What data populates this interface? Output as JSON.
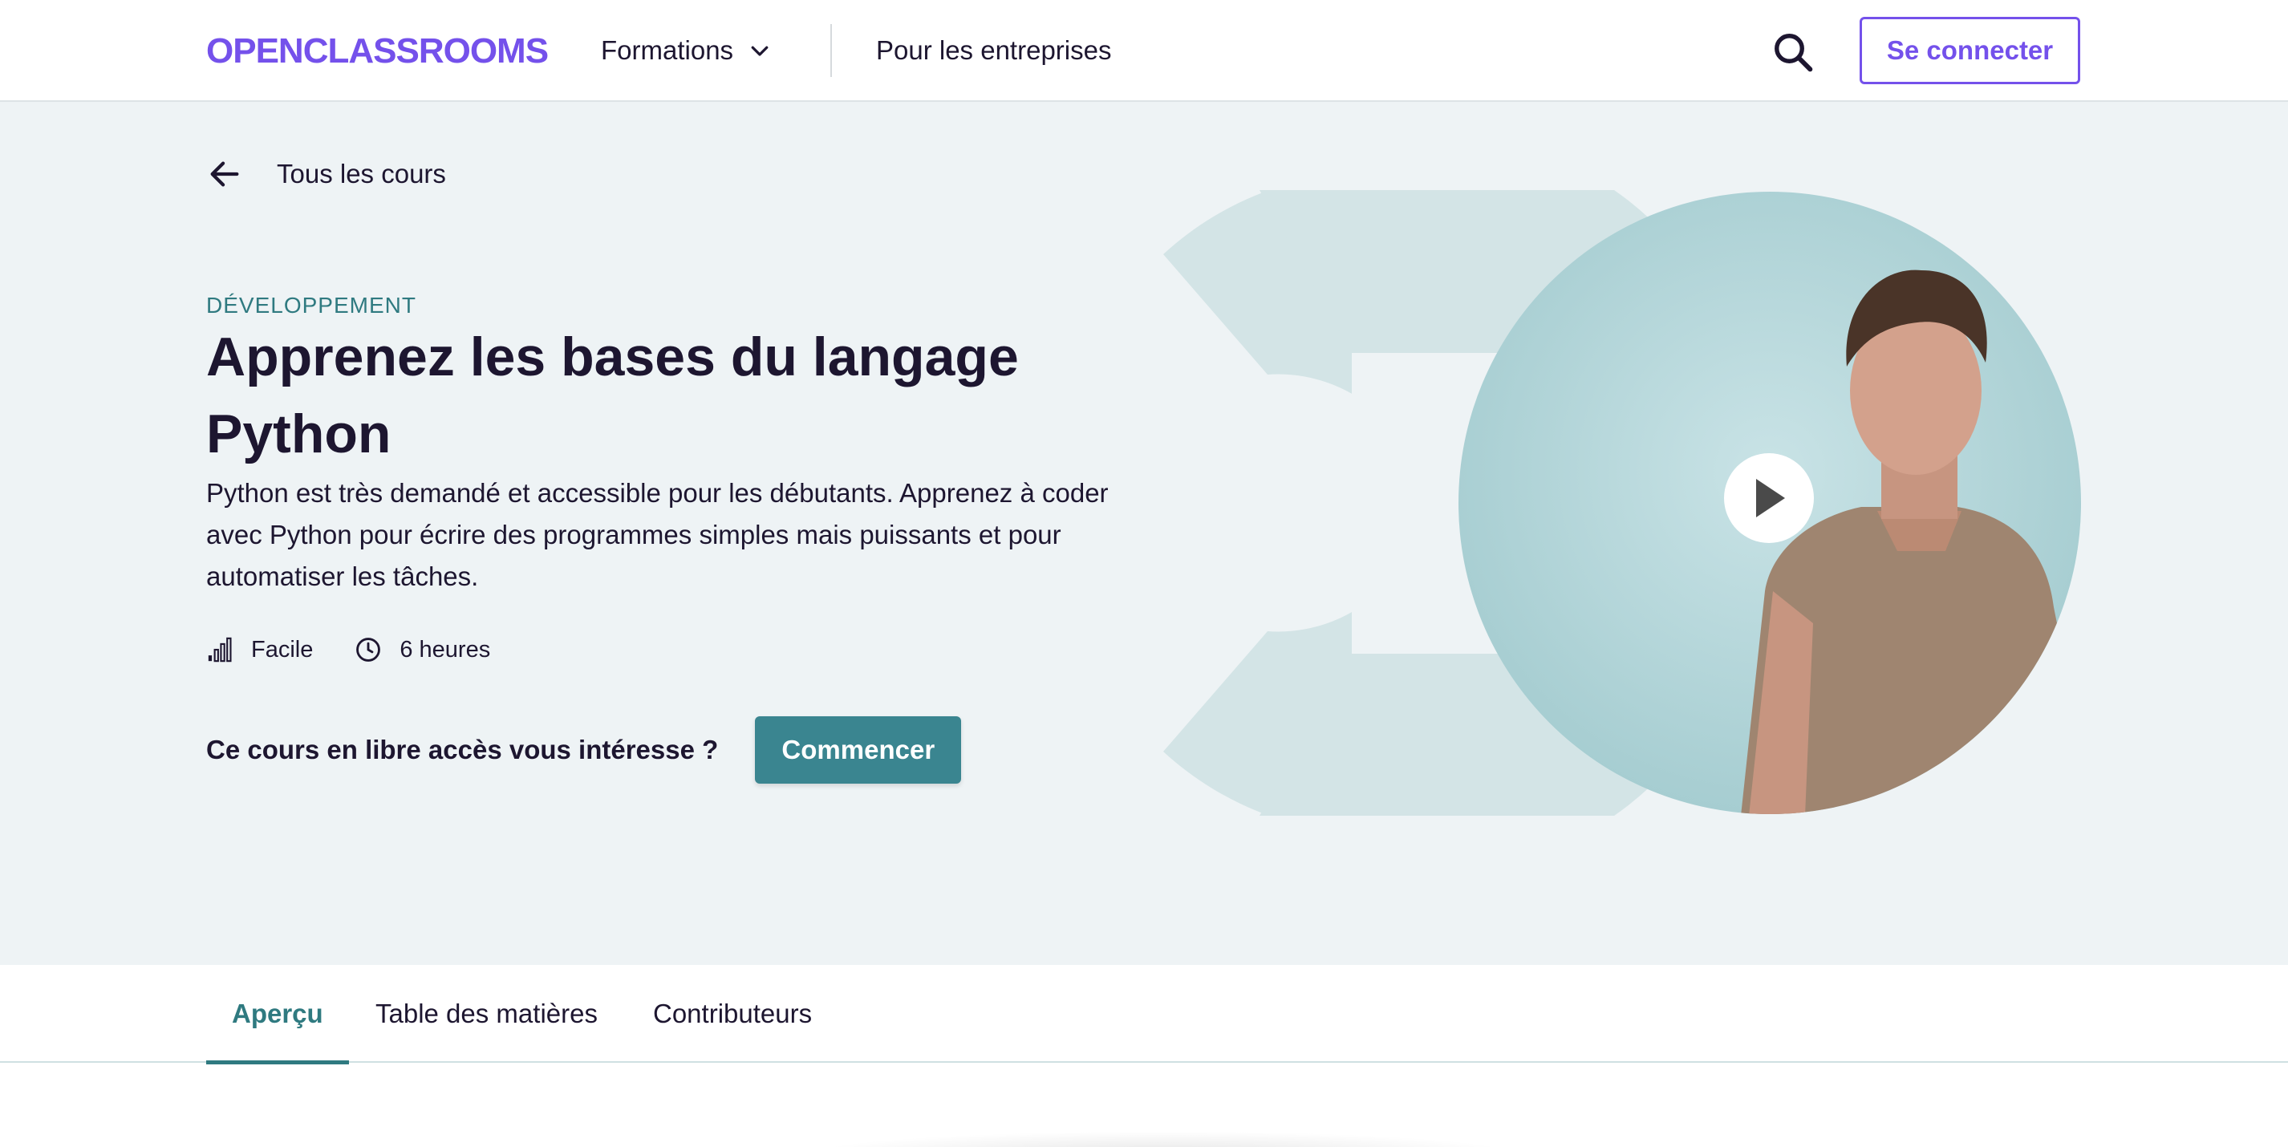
{
  "header": {
    "logo_text": "OPENCLASSROOMS",
    "nav_formations": "Formations",
    "nav_entreprises": "Pour les entreprises",
    "login_label": "Se connecter",
    "search_icon": "search-icon"
  },
  "hero": {
    "back_label": "Tous les cours",
    "category": "DÉVELOPPEMENT",
    "title": "Apprenez les bases du langage Python",
    "description": "Python est très demandé et accessible pour les débutants. Apprenez à coder avec Python pour écrire des programmes simples mais puissants et pour automatiser les tâches.",
    "difficulty": "Facile",
    "duration": "6 heures",
    "cta_question": "Ce cours en libre accès vous intéresse ?",
    "cta_label": "Commencer"
  },
  "tabs": [
    {
      "label": "Aperçu",
      "active": true
    },
    {
      "label": "Table des matières",
      "active": false
    },
    {
      "label": "Contributeurs",
      "active": false
    }
  ],
  "colors": {
    "brand": "#7451eb",
    "teal": "#3a8590",
    "hero_bg": "#eef3f5",
    "text": "#1d1630"
  }
}
